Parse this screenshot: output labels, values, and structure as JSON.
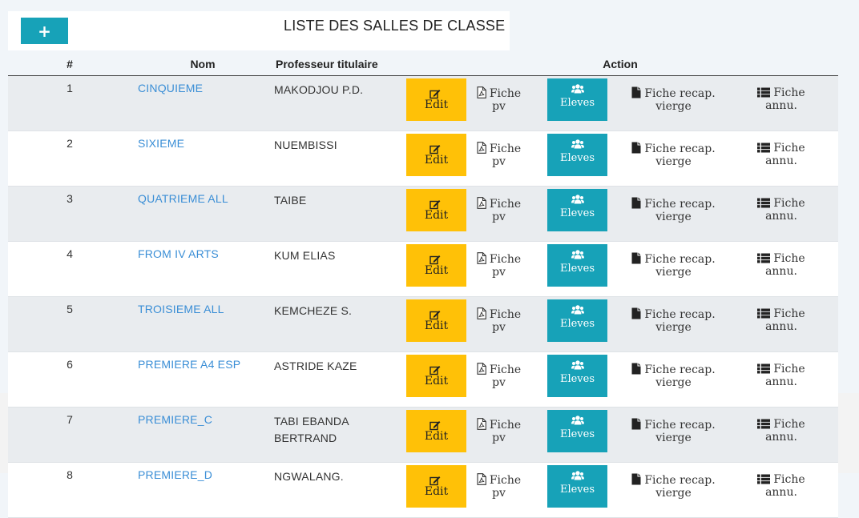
{
  "header": {
    "add_label": "+",
    "title": "LISTE DES SALLES DE CLASSE"
  },
  "table": {
    "columns": {
      "num": "#",
      "name": "Nom",
      "teacher": "Professeur titulaire",
      "action": "Action"
    },
    "action_labels": {
      "edit": "Edit",
      "fiche_pv_1": "Fiche",
      "fiche_pv_2": "pv",
      "eleves": "Eleves",
      "recap_1": "Fiche recap.",
      "recap_2": "vierge",
      "annu_1": "Fiche",
      "annu_2": "annu."
    },
    "rows": [
      {
        "num": "1",
        "name": "CINQUIEME",
        "teacher": "MAKODJOU P.D."
      },
      {
        "num": "2",
        "name": "SIXIEME",
        "teacher": "NUEMBISSI"
      },
      {
        "num": "3",
        "name": "QUATRIEME ALL",
        "teacher": "TAIBE"
      },
      {
        "num": "4",
        "name": "FROM IV ARTS",
        "teacher": "KUM ELIAS"
      },
      {
        "num": "5",
        "name": "TROISIEME ALL",
        "teacher": "KEMCHEZE S."
      },
      {
        "num": "6",
        "name": "PREMIERE A4 ESP",
        "teacher": "ASTRIDE KAZE"
      },
      {
        "num": "7",
        "name": "PREMIERE_C",
        "teacher": "TABI EBANDA BERTRAND"
      },
      {
        "num": "8",
        "name": "PREMIERE_D",
        "teacher": "NGWALANG."
      }
    ]
  },
  "icons": {
    "add": "plus-icon",
    "edit": "edit-icon",
    "fiche_pv": "pdf-file-icon",
    "eleves": "users-icon",
    "recap": "file-icon",
    "annu": "list-icon"
  },
  "colors": {
    "accent": "#17a2b8",
    "warning": "#ffc107",
    "link": "#3a8ed6",
    "row_striped": "#e9ecef"
  }
}
